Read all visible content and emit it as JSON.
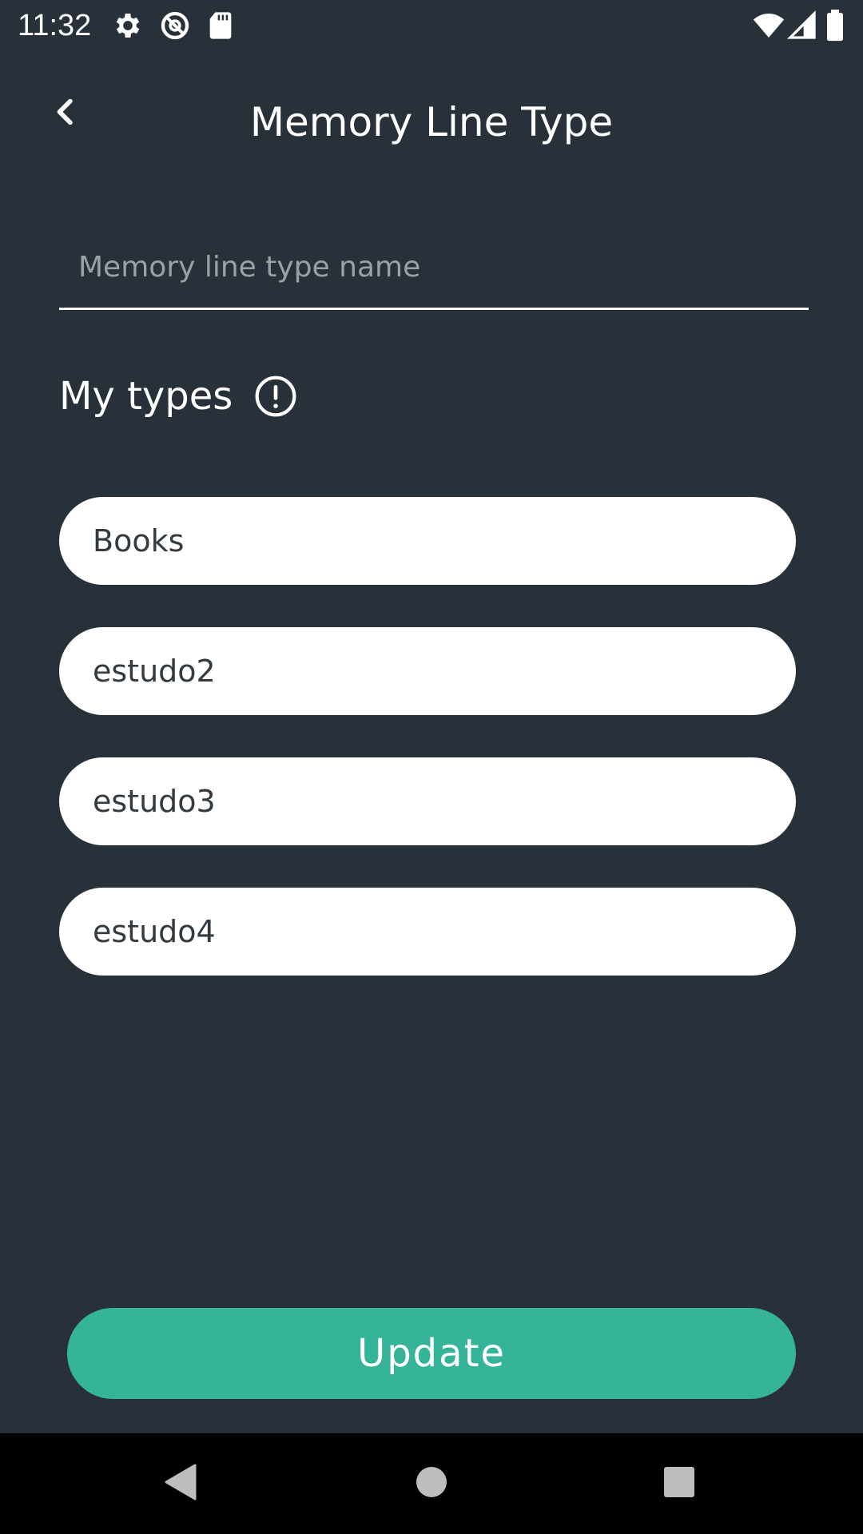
{
  "status_bar": {
    "time": "11:32",
    "icons": [
      "gear-icon",
      "data-saver-icon",
      "sd-card-icon",
      "wifi-icon",
      "signal-icon",
      "battery-icon"
    ]
  },
  "header": {
    "title": "Memory Line Type",
    "back_icon": "chevron-left-icon"
  },
  "form": {
    "name_placeholder": "Memory line type name",
    "name_value": ""
  },
  "types_section": {
    "title": "My types",
    "info_icon": "info-circle-icon",
    "items": [
      {
        "label": "Books"
      },
      {
        "label": "estudo2"
      },
      {
        "label": "estudo3"
      },
      {
        "label": "estudo4"
      }
    ]
  },
  "actions": {
    "update_label": "Update"
  },
  "nav_bar": {
    "buttons": [
      "back-triangle-icon",
      "home-circle-icon",
      "recents-square-icon"
    ]
  },
  "colors": {
    "background": "#283139",
    "accent": "#36b499",
    "item_background": "#ffffff",
    "item_text": "#333a40",
    "nav_background": "#000000"
  }
}
